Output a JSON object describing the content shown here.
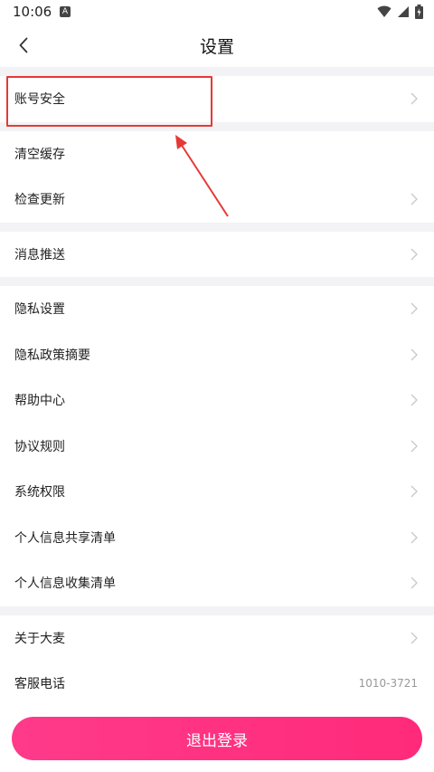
{
  "status_bar": {
    "time": "10:06",
    "badge": "A"
  },
  "header": {
    "title": "设置"
  },
  "sections": [
    {
      "items": [
        {
          "label": "账号安全",
          "chevron": true
        }
      ]
    },
    {
      "items": [
        {
          "label": "清空缓存",
          "chevron": false
        },
        {
          "label": "检查更新",
          "chevron": true
        }
      ]
    },
    {
      "items": [
        {
          "label": "消息推送",
          "chevron": true
        }
      ]
    },
    {
      "items": [
        {
          "label": "隐私设置",
          "chevron": true
        },
        {
          "label": "隐私政策摘要",
          "chevron": true
        },
        {
          "label": "帮助中心",
          "chevron": true
        },
        {
          "label": "协议规则",
          "chevron": true
        },
        {
          "label": "系统权限",
          "chevron": true
        },
        {
          "label": "个人信息共享清单",
          "chevron": true
        },
        {
          "label": "个人信息收集清单",
          "chevron": true
        }
      ]
    },
    {
      "items": [
        {
          "label": "关于大麦",
          "chevron": true
        },
        {
          "label": "客服电话",
          "value": "1010-3721"
        }
      ]
    }
  ],
  "footer": {
    "logout_label": "退出登录"
  },
  "colors": {
    "accent": "#ff2e80",
    "annotation": "#e53935",
    "divider_bg": "#f3f3f5"
  }
}
